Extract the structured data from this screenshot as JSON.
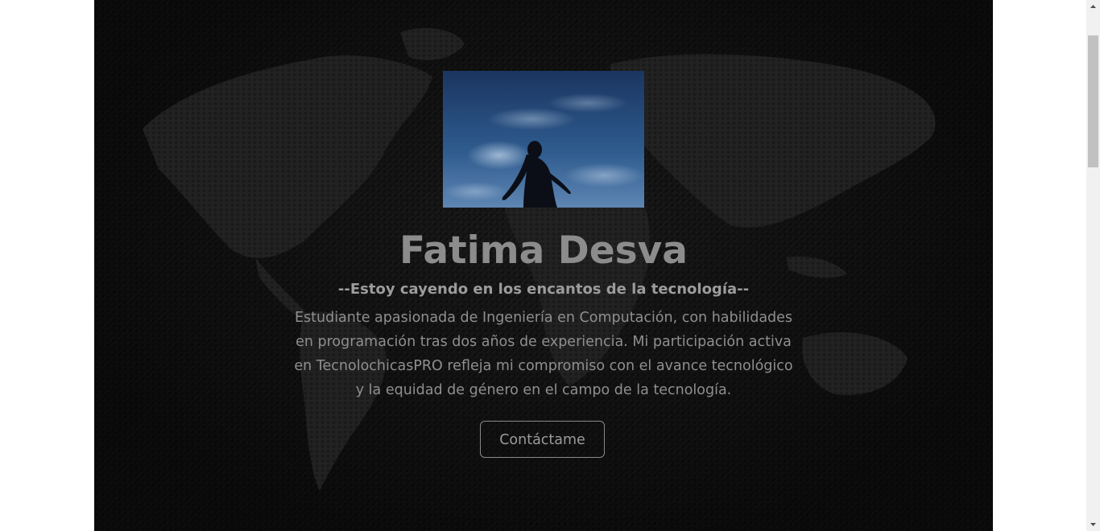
{
  "hero": {
    "name": "Fatima Desva",
    "tagline": "--Estoy cayendo en los encantos de la tecnología--",
    "bio": "Estudiante apasionada de Ingeniería en Computación, con habilidades en programación tras dos años de experiencia. Mi participación activa en TecnolochicasPRO refleja mi compromiso con el avance tecnológico y la equidad de género en el campo de la tecnología.",
    "contact_label": "Contáctame",
    "photo_alt": "Fatima Desva"
  },
  "scrollbar": {
    "up_icon": "triangle-up",
    "down_icon": "triangle-down"
  },
  "colors": {
    "hero_background": "#171717",
    "text_primary": "#8c8c8c",
    "button_border": "#8a8a8a"
  }
}
